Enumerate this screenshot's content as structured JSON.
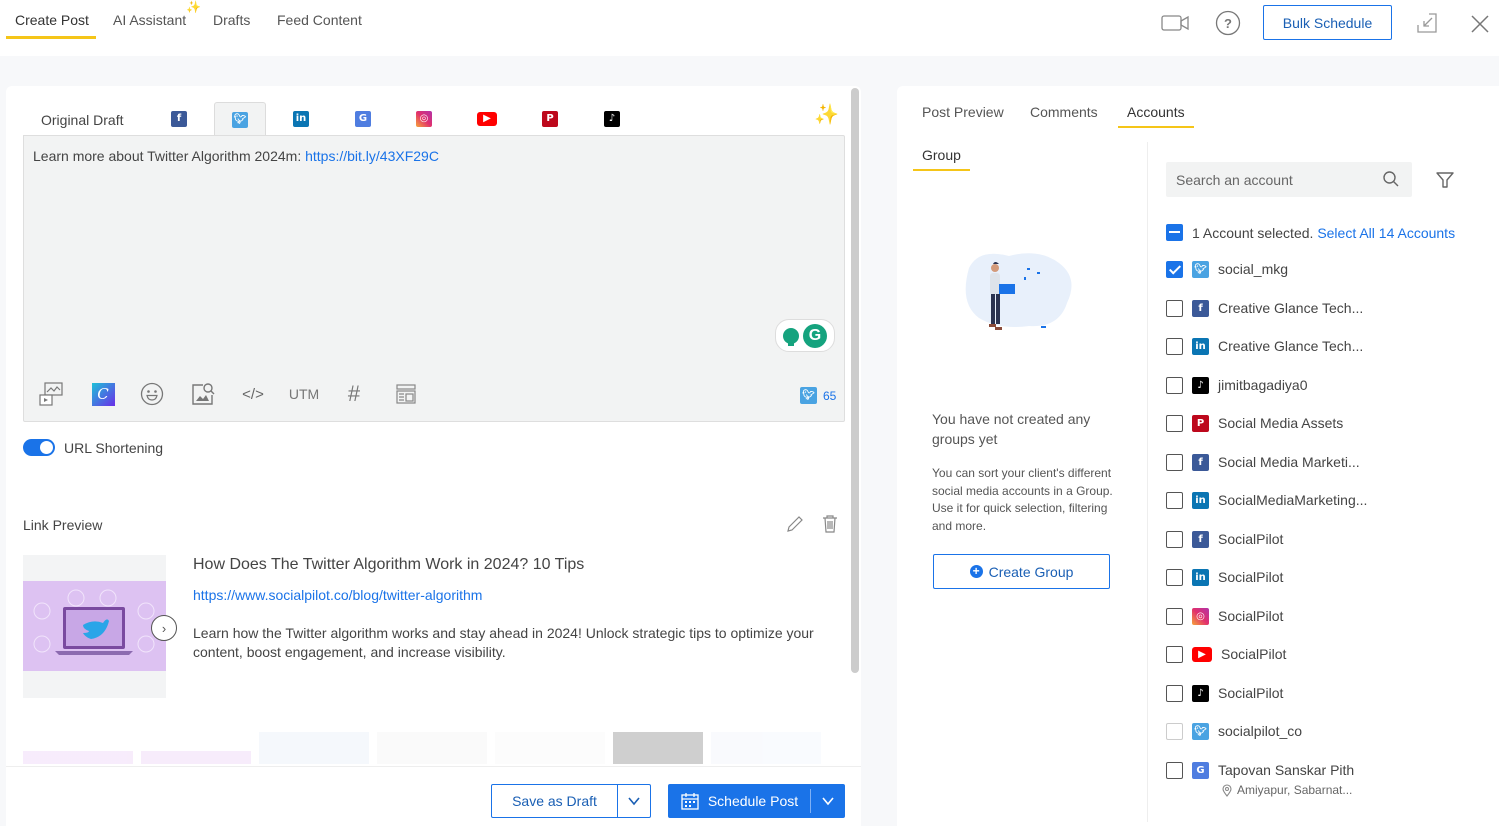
{
  "topbar": {
    "tabs": [
      {
        "label": "Create Post",
        "active": true
      },
      {
        "label": "AI Assistant",
        "active": false
      },
      {
        "label": "Drafts",
        "active": false
      },
      {
        "label": "Feed Content",
        "active": false
      }
    ],
    "bulk_schedule_label": "Bulk Schedule",
    "icons": [
      "video-icon",
      "help-icon",
      "minimize-icon",
      "close-icon"
    ]
  },
  "composer": {
    "original_draft_label": "Original Draft",
    "network_tabs": [
      {
        "network": "facebook",
        "glyph": "f",
        "active": false
      },
      {
        "network": "twitter",
        "glyph": "t",
        "active": true
      },
      {
        "network": "linkedin",
        "glyph": "in",
        "active": false
      },
      {
        "network": "google-business",
        "glyph": "G",
        "active": false
      },
      {
        "network": "instagram",
        "glyph": "◎",
        "active": false
      },
      {
        "network": "youtube",
        "glyph": "▶",
        "active": false
      },
      {
        "network": "pinterest",
        "glyph": "P",
        "active": false
      },
      {
        "network": "tiktok",
        "glyph": "♪",
        "active": false
      }
    ],
    "text_prefix": "Learn more about Twitter Algorithm 2024m: ",
    "text_link": "https://bit.ly/43XF29C",
    "toolbar": {
      "utm_label": "UTM",
      "hashtag_label": "#",
      "code_label": "</>",
      "canva_label": "C"
    },
    "char_count": "65",
    "url_shortening_label": "URL Shortening",
    "url_shortening_on": true
  },
  "link_preview": {
    "label": "Link Preview",
    "title": "How Does The Twitter Algorithm Work in 2024? 10 Tips",
    "url": "https://www.socialpilot.co/blog/twitter-algorithm",
    "description": "Learn how the Twitter algorithm works and stay ahead in 2024! Unlock strategic tips to optimize your content, boost engagement, and increase visibility."
  },
  "footer": {
    "save_draft_label": "Save as Draft",
    "schedule_label": "Schedule Post"
  },
  "right_panel": {
    "tabs": [
      {
        "label": "Post Preview",
        "active": false
      },
      {
        "label": "Comments",
        "active": false
      },
      {
        "label": "Accounts",
        "active": true
      }
    ],
    "group_tab_label": "Group",
    "empty_title": "You have not created any groups yet",
    "empty_desc": "You can sort your client's different social media accounts in a Group. Use it for quick selection, filtering and more.",
    "create_group_label": "Create Group",
    "search_placeholder": "Search an account",
    "selection_text": "1 Account selected. ",
    "select_all_label": "Select All 14 Accounts",
    "accounts": [
      {
        "name": "social_mkg",
        "network": "twitter",
        "checked": true
      },
      {
        "name": "Creative Glance Tech...",
        "network": "facebook",
        "checked": false
      },
      {
        "name": "Creative Glance Tech...",
        "network": "linkedin",
        "checked": false
      },
      {
        "name": "jimitbagadiya0",
        "network": "tiktok",
        "checked": false
      },
      {
        "name": "Social Media Assets",
        "network": "pinterest",
        "checked": false
      },
      {
        "name": "Social Media Marketi...",
        "network": "facebook",
        "checked": false
      },
      {
        "name": "SocialMediaMarketing...",
        "network": "linkedin",
        "checked": false
      },
      {
        "name": "SocialPilot",
        "network": "facebook",
        "checked": false
      },
      {
        "name": "SocialPilot",
        "network": "linkedin",
        "checked": false
      },
      {
        "name": "SocialPilot",
        "network": "instagram",
        "checked": false
      },
      {
        "name": "SocialPilot",
        "network": "youtube",
        "checked": false
      },
      {
        "name": "SocialPilot",
        "network": "tiktok",
        "checked": false
      },
      {
        "name": "socialpilot_co",
        "network": "twitter",
        "checked": false,
        "disabled": true
      },
      {
        "name": "Tapovan Sanskar Pith",
        "network": "google-business",
        "checked": false,
        "location": "Amiyapur, Sabarnat..."
      }
    ]
  },
  "colors": {
    "accent": "#1a73e8",
    "tab_underline": "#f5c518",
    "twitter": "#4aa3e2",
    "facebook": "#3b5998",
    "linkedin": "#0a75b3",
    "pinterest": "#bd081c",
    "youtube": "#ff0000",
    "tiktok": "#000000"
  }
}
